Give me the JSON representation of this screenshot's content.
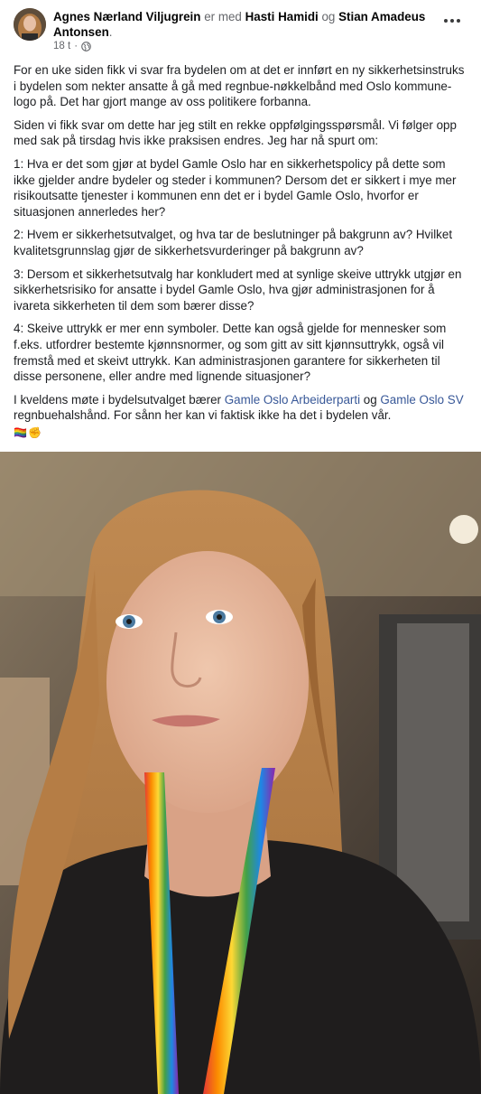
{
  "post": {
    "author": "Agnes Nærland Viljugrein",
    "with_word": "er med",
    "tagged_1": "Hasti Hamidi",
    "and_word": "og",
    "tagged_2": "Stian Amadeus Antonsen",
    "period": ".",
    "time": "18 t",
    "dot": "·",
    "privacy_icon": "globe-icon",
    "more_icon": "more-options-icon",
    "paragraphs": [
      "For en uke siden fikk vi svar fra bydelen om at det er innført en ny sikkerhetsinstruks i bydelen som nekter ansatte å gå med regnbue-nøkkelbånd med Oslo kommune-logo på. Det har gjort mange av oss politikere forbanna.",
      "Siden vi fikk svar om dette har jeg stilt en rekke oppfølgingsspørsmål. Vi følger opp med sak på tirsdag hvis ikke praksisen endres. Jeg har nå spurt om:",
      "1: Hva er det som gjør at bydel Gamle Oslo har en sikkerhetspolicy på dette som ikke gjelder andre bydeler og steder i kommunen?  Dersom det er sikkert i mye mer risikoutsatte tjenester i kommunen enn det er i bydel Gamle Oslo, hvorfor er situasjonen annerledes her?",
      "2: Hvem er sikkerhetsutvalget, og hva tar de beslutninger på bakgrunn av? Hvilket kvalitetsgrunnslag gjør de sikkerhetsvurderinger på bakgrunn av?",
      "3: Dersom et sikkerhetsutvalg har konkludert med at synlige skeive uttrykk utgjør en sikkerhetsrisiko for ansatte i bydel Gamle Oslo, hva gjør administrasjonen for å ivareta sikkerheten til dem som bærer disse?",
      "4: Skeive uttrykk er mer enn symboler. Dette kan også gjelde for mennesker som f.eks. utfordrer bestemte kjønnsnormer, og som gitt av sitt kjønnsuttrykk, også vil fremstå med et skeivt uttrykk. Kan administrasjonen garantere for sikkerheten til disse personene, eller andre med lignende situasjoner?"
    ],
    "last_paragraph": {
      "before": "I kveldens møte i bydelsutvalget bærer ",
      "link_1": "Gamle Oslo Arbeiderparti",
      "middle": " og ",
      "link_2": "Gamle Oslo SV",
      "after": " regnbuehalshånd. For sånn her kan vi faktisk ikke ha det i bydelen vår."
    },
    "emojis": "🏳️‍🌈✊"
  },
  "colors": {
    "text": "#1c1e21",
    "secondary": "#65676b",
    "link": "#385898"
  }
}
